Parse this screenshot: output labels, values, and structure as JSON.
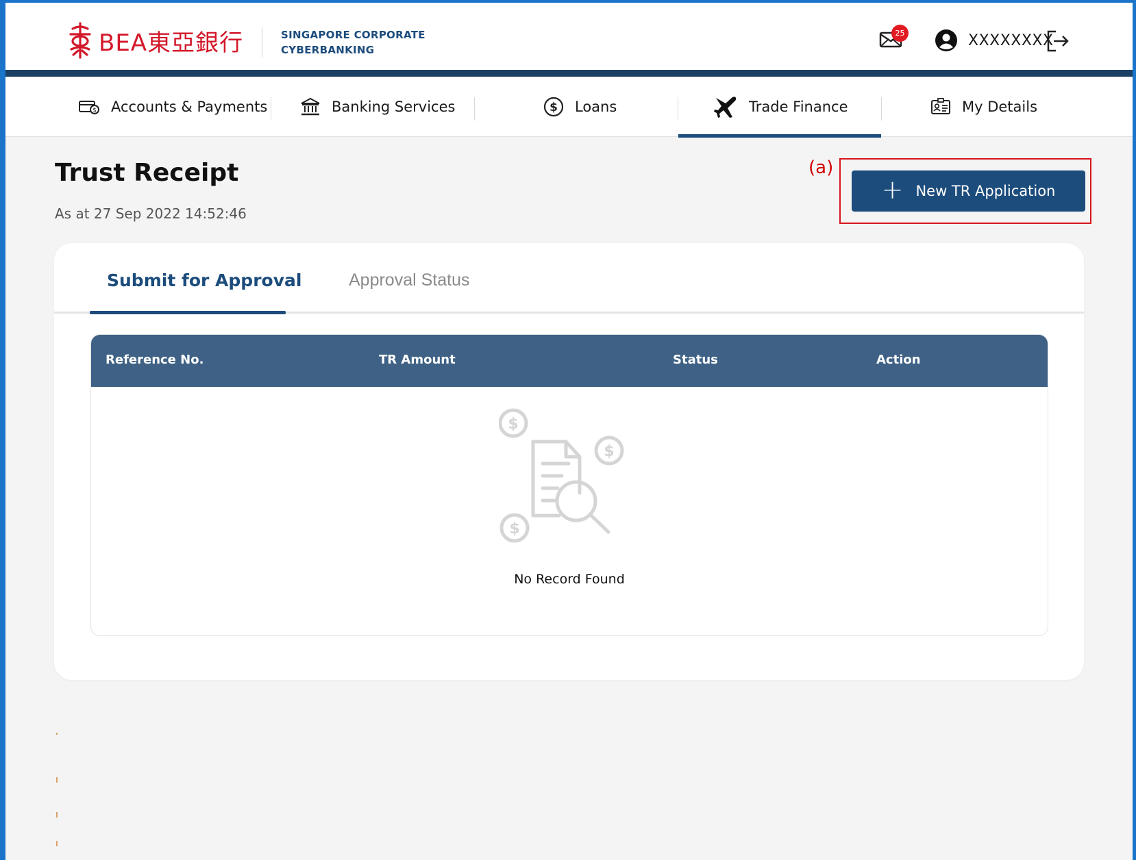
{
  "header": {
    "logo_text": "BEA東亞銀行",
    "subtitle_line1": "SINGAPORE CORPORATE",
    "subtitle_line2": "CYBERBANKING",
    "mail_badge": "25",
    "username": "XXXXXXXX"
  },
  "nav": {
    "items": [
      {
        "label": "Accounts & Payments",
        "icon": "card-payment-icon"
      },
      {
        "label": "Banking Services",
        "icon": "bank-building-icon"
      },
      {
        "label": "Loans",
        "icon": "dollar-circle-icon"
      },
      {
        "label": "Trade Finance",
        "icon": "airplane-icon",
        "active": true
      },
      {
        "label": "My Details",
        "icon": "id-card-icon"
      }
    ]
  },
  "page": {
    "title": "Trust Receipt",
    "as_at": "As at 27 Sep 2022 14:52:46",
    "annotation": "(a)",
    "new_button": "New TR Application"
  },
  "tabs": {
    "active": "Submit for Approval",
    "inactive": "Approval Status"
  },
  "table": {
    "columns": [
      "Reference No.",
      "TR Amount",
      "Status",
      "Action"
    ],
    "empty_message": "No Record Found"
  },
  "colors": {
    "brand_red": "#d3182a",
    "navy": "#1c4c7c",
    "table_header": "#3e6185",
    "annotation_red": "#d8141e"
  }
}
